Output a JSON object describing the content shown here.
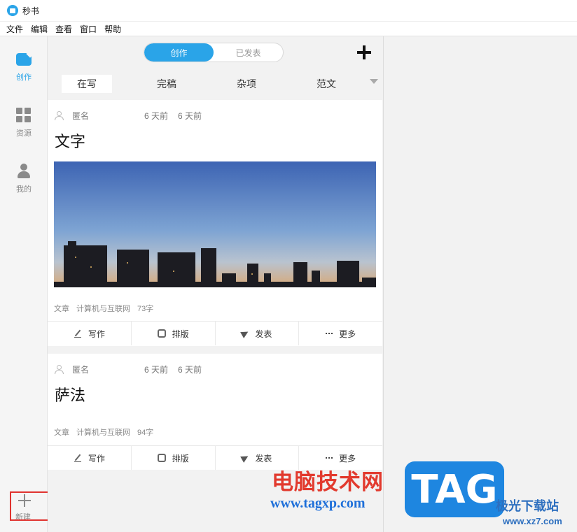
{
  "app": {
    "title": "秒书"
  },
  "menu": [
    "文件",
    "编辑",
    "查看",
    "窗口",
    "帮助"
  ],
  "sidebar": {
    "items": [
      {
        "label": "创作",
        "icon": "create-icon",
        "active": true
      },
      {
        "label": "资源",
        "icon": "resources-icon",
        "active": false
      },
      {
        "label": "我的",
        "icon": "profile-icon",
        "active": false
      }
    ],
    "new_label": "新建"
  },
  "header": {
    "segments": [
      {
        "label": "创作",
        "active": true
      },
      {
        "label": "已发表",
        "active": false
      }
    ]
  },
  "tabs": [
    {
      "label": "在写",
      "active": true
    },
    {
      "label": "完稿",
      "active": false
    },
    {
      "label": "杂项",
      "active": false
    },
    {
      "label": "范文",
      "active": false
    }
  ],
  "cards": [
    {
      "author": "匿名",
      "created": "6 天前",
      "modified": "6 天前",
      "title": "文字",
      "has_image": true,
      "footer": {
        "type": "文章",
        "category": "计算机与互联网",
        "count": "73字"
      }
    },
    {
      "author": "匿名",
      "created": "6 天前",
      "modified": "6 天前",
      "title": "萨法",
      "has_image": false,
      "footer": {
        "type": "文章",
        "category": "计算机与互联网",
        "count": "94字"
      }
    }
  ],
  "actions": [
    "写作",
    "排版",
    "发表",
    "更多"
  ],
  "watermark": {
    "brand": "电脑技术网",
    "url": "www.tagxp.com",
    "tag": "TAG",
    "site_name": "极光下载站",
    "site_url": "www.xz7.com"
  },
  "colors": {
    "accent": "#2aa4e8",
    "highlight_box": "#e0332f"
  }
}
